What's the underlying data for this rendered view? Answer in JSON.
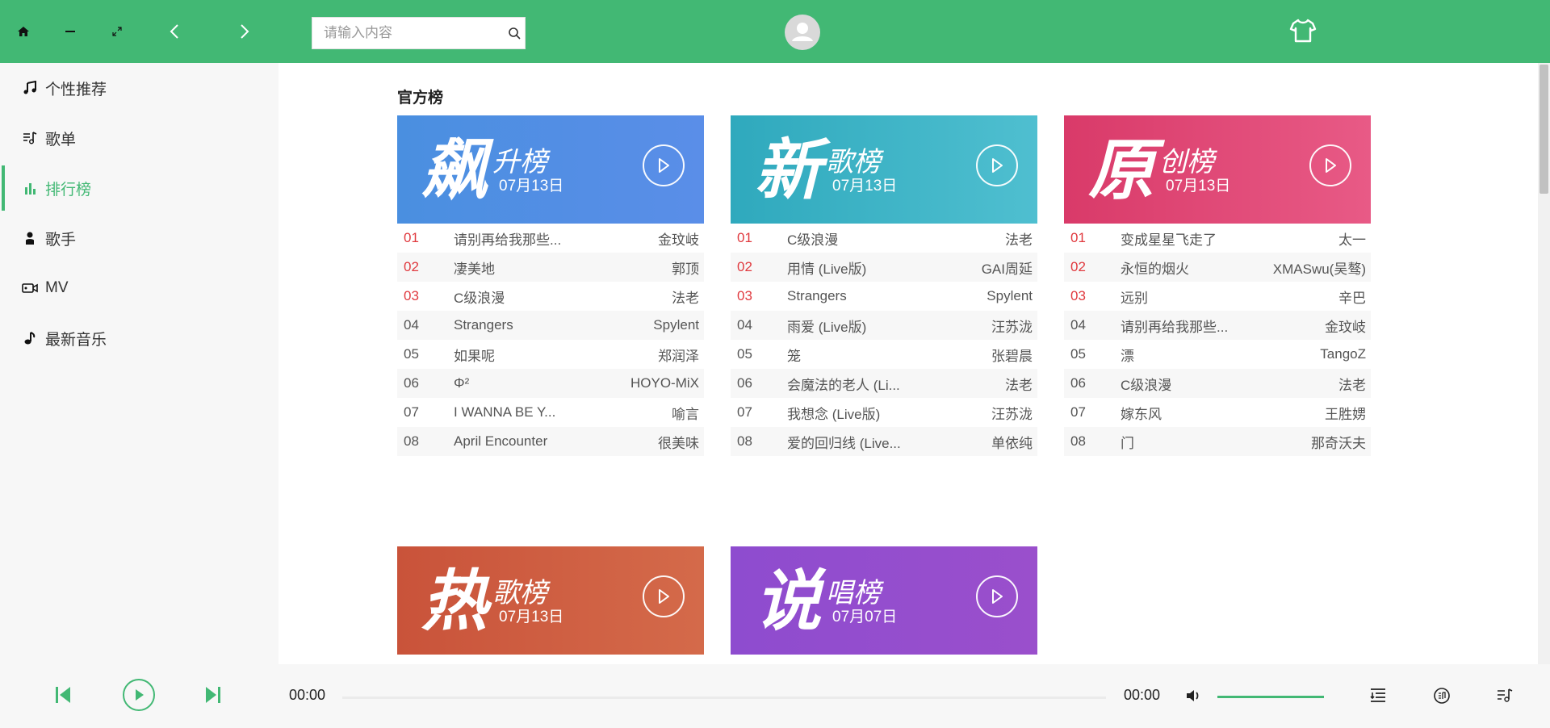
{
  "colors": {
    "accent": "#42b874",
    "topbar": "#42b874",
    "rank_top": "#e0393e"
  },
  "header": {
    "search_placeholder": "请输入内容",
    "icons": [
      "home-icon",
      "minimize-icon",
      "fullscreen-icon",
      "back-icon",
      "forward-icon",
      "search-icon",
      "avatar-icon",
      "tshirt-icon"
    ]
  },
  "sidebar": {
    "items": [
      {
        "label": "个性推荐",
        "icon": "music-note-icon",
        "active": false
      },
      {
        "label": "歌单",
        "icon": "playlist-icon",
        "active": false
      },
      {
        "label": "排行榜",
        "icon": "chart-icon",
        "active": true
      },
      {
        "label": "歌手",
        "icon": "person-icon",
        "active": false
      },
      {
        "label": "MV",
        "icon": "video-icon",
        "active": false
      },
      {
        "label": "最新音乐",
        "icon": "new-music-icon",
        "active": false
      }
    ]
  },
  "main": {
    "section_title": "官方榜",
    "charts": [
      {
        "char": "飙",
        "subtitle": "升榜",
        "date": "07月13日",
        "songs": [
          {
            "idx": "01",
            "name": "请别再给我那些...",
            "artist": "金玟岐"
          },
          {
            "idx": "02",
            "name": "凄美地",
            "artist": "郭顶"
          },
          {
            "idx": "03",
            "name": "C级浪漫",
            "artist": "法老"
          },
          {
            "idx": "04",
            "name": "Strangers",
            "artist": "Spylent"
          },
          {
            "idx": "05",
            "name": "如果呢",
            "artist": "郑润泽"
          },
          {
            "idx": "06",
            "name": "Φ²",
            "artist": "HOYO-MiX"
          },
          {
            "idx": "07",
            "name": "I WANNA BE Y...",
            "artist": "喻言"
          },
          {
            "idx": "08",
            "name": "April Encounter",
            "artist": "很美味"
          }
        ]
      },
      {
        "char": "新",
        "subtitle": "歌榜",
        "date": "07月13日",
        "songs": [
          {
            "idx": "01",
            "name": "C级浪漫",
            "artist": "法老"
          },
          {
            "idx": "02",
            "name": "用情 (Live版)",
            "artist": "GAI周延"
          },
          {
            "idx": "03",
            "name": "Strangers",
            "artist": "Spylent"
          },
          {
            "idx": "04",
            "name": "雨爱 (Live版)",
            "artist": "汪苏泷"
          },
          {
            "idx": "05",
            "name": "笼",
            "artist": "张碧晨"
          },
          {
            "idx": "06",
            "name": "会魔法的老人 (Li...",
            "artist": "法老"
          },
          {
            "idx": "07",
            "name": "我想念 (Live版)",
            "artist": "汪苏泷"
          },
          {
            "idx": "08",
            "name": "爱的回归线 (Live...",
            "artist": "单依纯"
          }
        ]
      },
      {
        "char": "原",
        "subtitle": "创榜",
        "date": "07月13日",
        "songs": [
          {
            "idx": "01",
            "name": "变成星星飞走了",
            "artist": "太一"
          },
          {
            "idx": "02",
            "name": "永恒的烟火",
            "artist": "XMASwu(吴骜)"
          },
          {
            "idx": "03",
            "name": "远别",
            "artist": "辛巴"
          },
          {
            "idx": "04",
            "name": "请别再给我那些...",
            "artist": "金玟岐"
          },
          {
            "idx": "05",
            "name": "漂",
            "artist": "TangoZ"
          },
          {
            "idx": "06",
            "name": "C级浪漫",
            "artist": "法老"
          },
          {
            "idx": "07",
            "name": "嫁东风",
            "artist": "王胜娚"
          },
          {
            "idx": "08",
            "name": "门",
            "artist": "那奇沃夫"
          }
        ]
      },
      {
        "char": "热",
        "subtitle": "歌榜",
        "date": "07月13日",
        "songs": []
      },
      {
        "char": "说",
        "subtitle": "唱榜",
        "date": "07月07日",
        "songs": []
      }
    ]
  },
  "player": {
    "current_time": "00:00",
    "total_time": "00:00",
    "volume": 1.0,
    "progress": 0,
    "icons": [
      "prev-track-icon",
      "play-icon",
      "next-track-icon",
      "volume-icon",
      "playlist-queue-icon",
      "lyrics-icon",
      "song-list-icon"
    ]
  }
}
